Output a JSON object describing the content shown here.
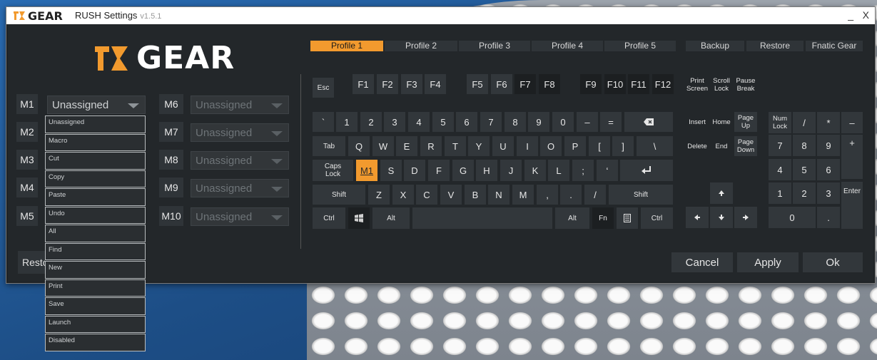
{
  "window": {
    "title": "RUSH Settings",
    "version": "v1.5.1",
    "logo_text": "GEAR",
    "minimize": "_",
    "close": "X"
  },
  "brand": {
    "logo_text": "GEAR",
    "accent": "#f29a2e"
  },
  "macro_keys": [
    {
      "label": "M1",
      "value": "Unassigned"
    },
    {
      "label": "M2",
      "value": ""
    },
    {
      "label": "M3",
      "value": ""
    },
    {
      "label": "M4",
      "value": ""
    },
    {
      "label": "M5",
      "value": ""
    },
    {
      "label": "M6",
      "value": "Unassigned"
    },
    {
      "label": "M7",
      "value": "Unassigned"
    },
    {
      "label": "M8",
      "value": "Unassigned"
    },
    {
      "label": "M9",
      "value": "Unassigned"
    },
    {
      "label": "M10",
      "value": "Unassigned"
    }
  ],
  "dropdown_options": [
    "Unassigned",
    "Macro",
    "Cut",
    "Copy",
    "Paste",
    "Undo",
    "All",
    "Find",
    "New",
    "Print",
    "Save",
    "Launch",
    "Disabled"
  ],
  "restore_left": "Restore",
  "profiles": [
    "Profile 1",
    "Profile 2",
    "Profile 3",
    "Profile 4",
    "Profile 5"
  ],
  "active_profile": "Profile 1",
  "actions": {
    "backup": "Backup",
    "restore": "Restore",
    "fnatic_gear": "Fnatic Gear"
  },
  "buttons": {
    "cancel": "Cancel",
    "apply": "Apply",
    "ok": "Ok"
  },
  "keys": {
    "esc": "Esc",
    "f": [
      "F1",
      "F2",
      "F3",
      "F4",
      "F5",
      "F6",
      "F7",
      "F8",
      "F9",
      "F10",
      "F11",
      "F12"
    ],
    "print_screen": [
      "Print",
      "Screen"
    ],
    "scroll_lock": [
      "Scroll",
      "Lock"
    ],
    "pause_break": [
      "Pause",
      "Break"
    ],
    "number_row": [
      "`",
      "1",
      "2",
      "3",
      "4",
      "5",
      "6",
      "7",
      "8",
      "9",
      "0",
      "–",
      "="
    ],
    "tab": "Tab",
    "qwerty": [
      "Q",
      "W",
      "E",
      "R",
      "T",
      "Y",
      "U",
      "I",
      "O",
      "P",
      "[",
      "]",
      "\\"
    ],
    "caps": [
      "Caps",
      "Lock"
    ],
    "asdf": [
      "S",
      "D",
      "F",
      "G",
      "H",
      "J",
      "K",
      "L",
      ";",
      "‘"
    ],
    "caps_assigned": "M1",
    "shift": "Shift",
    "zxcv": [
      "Z",
      "X",
      "C",
      "V",
      "B",
      "N",
      "M",
      ",",
      ".",
      "/"
    ],
    "ctrl": "Ctrl",
    "alt": "Alt",
    "fn": "Fn",
    "nav": {
      "insert": "Insert",
      "home": "Home",
      "page_up": [
        "Page",
        "Up"
      ],
      "delete": "Delete",
      "end": "End",
      "page_down": [
        "Page",
        "Down"
      ]
    },
    "numpad": {
      "num_lock": [
        "Num",
        "Lock"
      ],
      "slash": "/",
      "star": "*",
      "minus": "–",
      "plus": "+",
      "enter": "Enter",
      "digits": [
        "7",
        "8",
        "9",
        "4",
        "5",
        "6",
        "1",
        "2",
        "3"
      ],
      "zero": "0",
      "dot": "."
    }
  }
}
